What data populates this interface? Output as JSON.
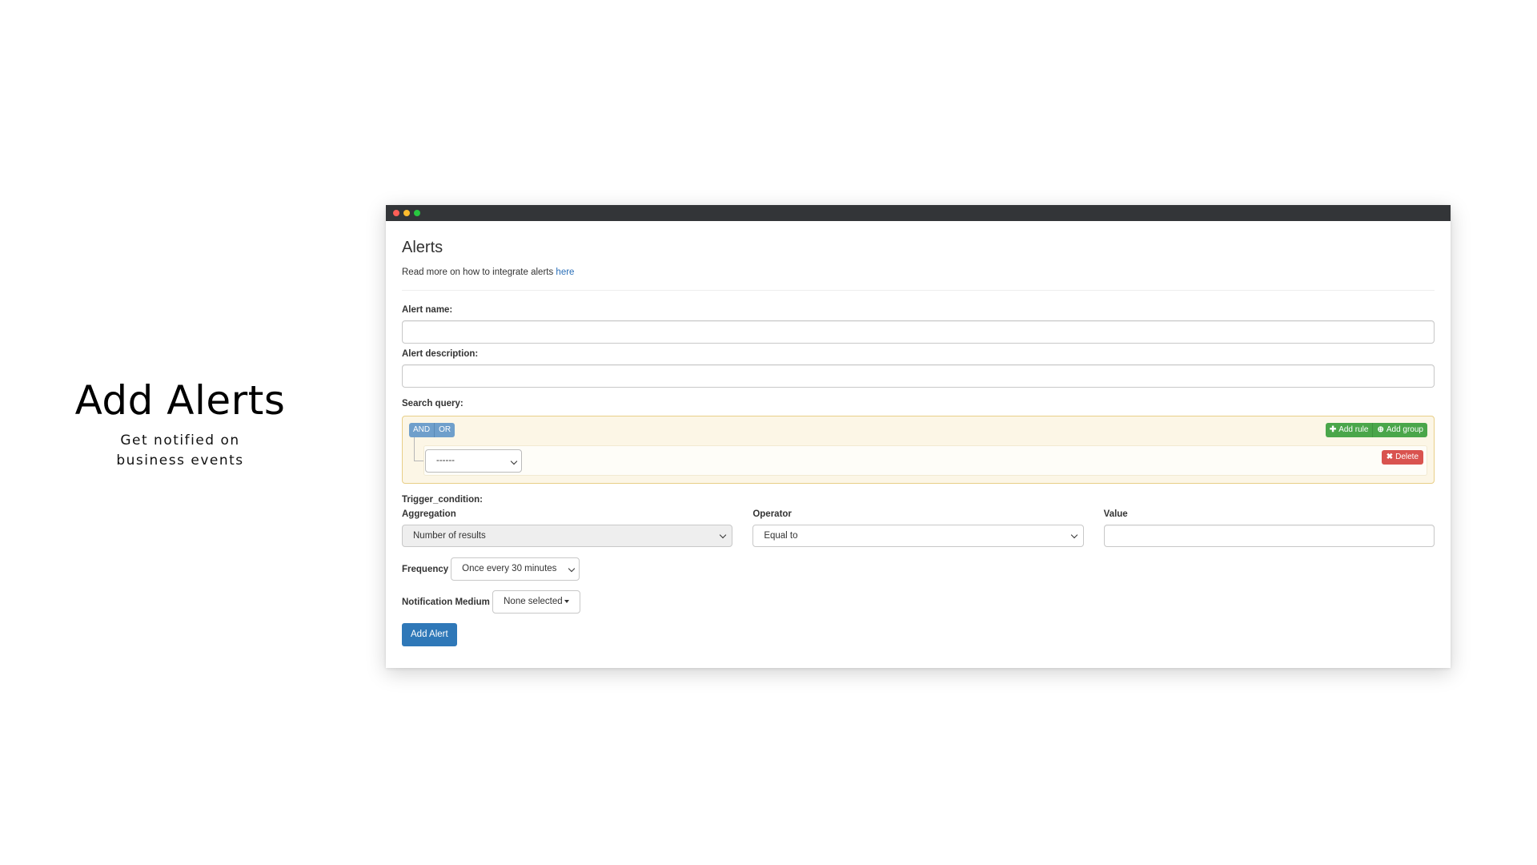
{
  "hero": {
    "title": "Add Alerts",
    "subtitle": "Get notified on business events"
  },
  "window": {
    "dots": [
      "#ff5f57",
      "#febc2e",
      "#28c840"
    ]
  },
  "page": {
    "title": "Alerts",
    "intro_text": "Read more on how to integrate alerts ",
    "intro_link": "here"
  },
  "form": {
    "alert_name_label": "Alert name:",
    "alert_name_value": "",
    "alert_description_label": "Alert description:",
    "alert_description_value": "",
    "search_query_label": "Search query:",
    "query_builder": {
      "and_label": "AND",
      "or_label": "OR",
      "add_rule_label": "Add rule",
      "add_group_label": "Add group",
      "rule_select_value": "------",
      "delete_label": "Delete"
    },
    "trigger_label": "Trigger_condition:",
    "aggregation_label": "Aggregation",
    "aggregation_value": "Number of results",
    "operator_label": "Operator",
    "operator_value": "Equal to",
    "value_label": "Value",
    "value_value": "",
    "frequency_label": "Frequency",
    "frequency_value": "Once every 30 minutes",
    "notification_label": "Notification Medium",
    "notification_value": "None selected",
    "submit_label": "Add Alert"
  },
  "colors": {
    "primary": "#2f78b8",
    "success": "#4aa64a",
    "danger": "#d9534f",
    "condition": "#6f9fcb",
    "query_bg": "#fcf6e6"
  }
}
